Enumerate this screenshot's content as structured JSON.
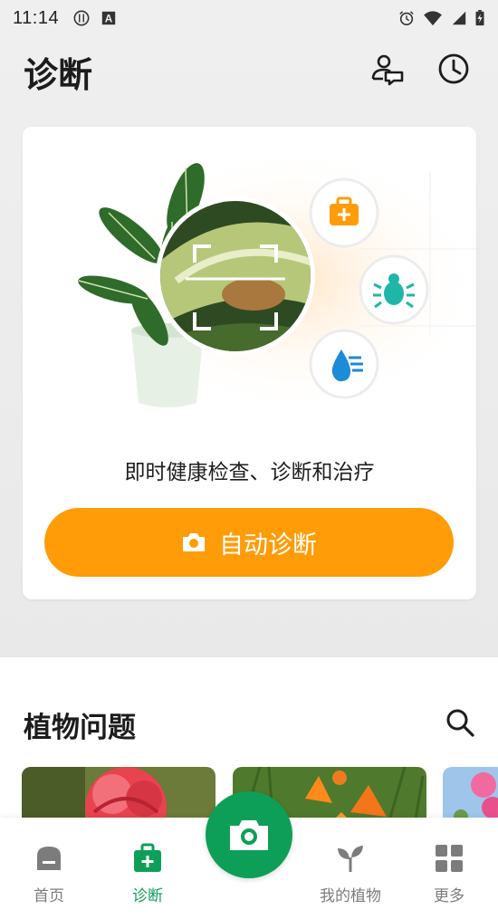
{
  "status_bar": {
    "time": "11:14",
    "left_icons": [
      "restaurant-icon",
      "font-a-icon"
    ],
    "right_icons": [
      "alarm-icon",
      "wifi-icon",
      "signal-icon",
      "battery-charging-icon"
    ]
  },
  "header": {
    "title": "诊断",
    "actions": [
      "expert-chat-icon",
      "history-clock-icon"
    ]
  },
  "diagnosis_card": {
    "tagline": "即时健康检查、诊断和治疗",
    "button_label": "自动诊断",
    "button_icon": "camera-icon",
    "hero_icons": [
      "medical-kit-icon",
      "bug-icon",
      "water-drop-icon"
    ]
  },
  "plant_problems": {
    "title": "植物问题",
    "search_icon": "search-icon",
    "thumbnails": [
      "red-rose-photo",
      "orange-lily-photo",
      "pink-blossom-photo"
    ]
  },
  "bottom_nav": {
    "items": [
      {
        "label": "首页",
        "icon": "home-icon",
        "active": false
      },
      {
        "label": "诊断",
        "icon": "diagnosis-kit-icon",
        "active": true
      },
      {
        "label": "我的植物",
        "icon": "sprout-icon",
        "active": false
      },
      {
        "label": "更多",
        "icon": "grid-icon",
        "active": false
      }
    ],
    "center_icon": "camera-icon"
  },
  "colors": {
    "accent_orange": "#ff9c08",
    "brand_green": "#0d9f58",
    "background_gray": "#efefef"
  }
}
